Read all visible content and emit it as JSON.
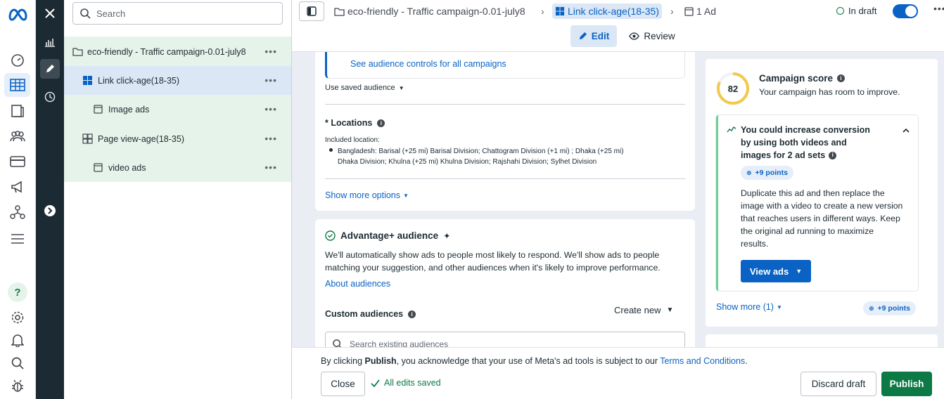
{
  "tree": {
    "search_placeholder": "Search",
    "items": [
      {
        "label": "eco-friendly - Traffic campaign-0.01-july8"
      },
      {
        "label": "Link click-age(18-35)"
      },
      {
        "label": "Image ads"
      },
      {
        "label": "Page view-age(18-35)"
      },
      {
        "label": "video ads"
      }
    ],
    "more": "•••"
  },
  "topbar": {
    "crumb_campaign": "eco-friendly - Traffic campaign-0.01-july8",
    "crumb_adset": "Link click-age(18-35)",
    "crumb_ad": "1 Ad",
    "status": "In draft",
    "edit_tab": "Edit",
    "review_tab": "Review"
  },
  "audience": {
    "audience_controls_link": "See audience controls for all campaigns",
    "use_saved": "Use saved audience",
    "locations_title": "* Locations",
    "included_label": "Included location:",
    "location_line1": "Bangladesh: Barisal (+25 mi) Barisal Division; Chattogram Division (+1 mi) ; Dhaka (+25 mi)",
    "location_line2": "Dhaka Division; Khulna (+25 mi) Khulna Division; Rajshahi Division; Sylhet Division",
    "show_more_options": "Show more options"
  },
  "advantage": {
    "title": "Advantage+ audience",
    "desc_line1": "We'll automatically show ads to people most likely to respond. We'll show ads to people",
    "desc_line2": "matching your suggestion, and other audiences when it's likely to improve performance.",
    "about_link": "About audiences",
    "custom_title": "Custom audiences",
    "create_new": "Create new",
    "search_placeholder": "Search existing audiences"
  },
  "score": {
    "value": "82",
    "fraction": 0.82,
    "title": "Campaign score",
    "subtitle": "Your campaign has room to improve.",
    "rec_line1": "You could increase conversion",
    "rec_line2": "by using both videos and",
    "rec_line3": "images for 2 ad sets",
    "points_badge": "+9 points",
    "body_line1": "Duplicate this ad and then replace the",
    "body_line2": "image with a video to create a new version",
    "body_line3": "that reaches users in different ways. Keep",
    "body_line4": "the original ad running to maximize",
    "body_line5": "results.",
    "view_ads": "View ads",
    "show_more": "Show more (1)",
    "footer_points": "+9 points"
  },
  "bottom": {
    "notice_prefix": "By clicking ",
    "notice_bold": "Publish",
    "notice_mid": ", you acknowledge that your use of Meta's ad tools is subject to our ",
    "notice_link": "Terms and Conditions",
    "notice_end": ".",
    "close": "Close",
    "saved": "All edits saved",
    "discard": "Discard draft",
    "publish": "Publish"
  },
  "colors": {
    "accent": "#0a63c4",
    "publish_green": "#0d7a45",
    "tree_highlight": "#e6f3ea",
    "rail_dark": "#1c2b33",
    "score_ring": "#f2c94c"
  }
}
